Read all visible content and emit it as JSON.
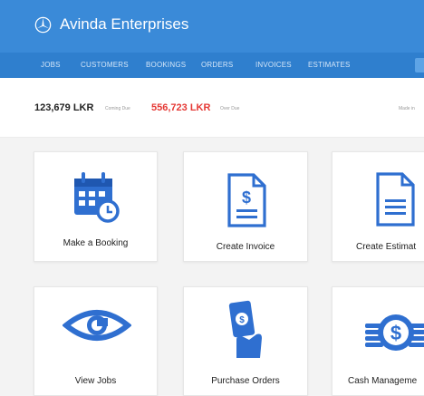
{
  "app": {
    "title": "Avinda Enterprises"
  },
  "nav": {
    "items": [
      "JOBS",
      "CUSTOMERS",
      "BOOKINGS",
      "ORDERS",
      "INVOICES",
      "ESTIMATES"
    ]
  },
  "stats": {
    "coming_due_amount": "123,679 LKR",
    "coming_due_label": "Coming Due",
    "over_due_amount": "556,723 LKR",
    "over_due_label": "Over Due",
    "made_in": "Made in"
  },
  "tiles": [
    {
      "label": "Make a Booking",
      "icon": "calendar-clock-icon"
    },
    {
      "label": "Create Invoice",
      "icon": "invoice-icon"
    },
    {
      "label": "Create Estimat",
      "icon": "estimate-icon"
    },
    {
      "label": "View Jobs",
      "icon": "eye-icon"
    },
    {
      "label": "Purchase Orders",
      "icon": "hand-money-icon"
    },
    {
      "label": "Cash Manageme",
      "icon": "coins-icon"
    }
  ],
  "colors": {
    "header": "#3a8ad8",
    "navbar": "#2f7fce",
    "icon_blue": "#2f6fd0",
    "over_due": "#e53935"
  }
}
